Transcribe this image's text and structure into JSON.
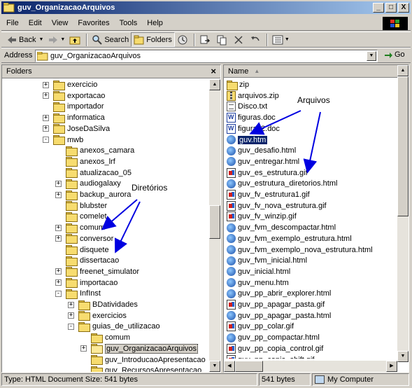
{
  "window": {
    "title": "guv_OrganizacaoArquivos"
  },
  "titlebar_buttons": [
    "_",
    "□",
    "X"
  ],
  "menu": [
    "File",
    "Edit",
    "View",
    "Favorites",
    "Tools",
    "Help"
  ],
  "toolbar": {
    "back": "Back",
    "search": "Search",
    "folders": "Folders"
  },
  "address": {
    "label": "Address",
    "value": "guv_OrganizacaoArquivos",
    "go": "Go"
  },
  "folders_pane": {
    "title": "Folders",
    "close": "×",
    "tree": [
      {
        "label": "exercicio",
        "level": 1,
        "expander": "+"
      },
      {
        "label": "exportacao",
        "level": 1,
        "expander": "+"
      },
      {
        "label": "importador",
        "level": 1,
        "expander": ""
      },
      {
        "label": "informatica",
        "level": 1,
        "expander": "+"
      },
      {
        "label": "JoseDaSilva",
        "level": 1,
        "expander": "+"
      },
      {
        "label": "mwb",
        "level": 1,
        "expander": "-"
      },
      {
        "label": "anexos_camara",
        "level": 2,
        "expander": ""
      },
      {
        "label": "anexos_lrf",
        "level": 2,
        "expander": ""
      },
      {
        "label": "atualizacao_05",
        "level": 2,
        "expander": ""
      },
      {
        "label": "audiogalaxy",
        "level": 2,
        "expander": "+"
      },
      {
        "label": "backup_aurora",
        "level": 2,
        "expander": "+"
      },
      {
        "label": "blubster",
        "level": 2,
        "expander": ""
      },
      {
        "label": "comelet",
        "level": 2,
        "expander": ""
      },
      {
        "label": "comum",
        "level": 2,
        "expander": "+"
      },
      {
        "label": "conversor",
        "level": 2,
        "expander": "+"
      },
      {
        "label": "disquete",
        "level": 2,
        "expander": ""
      },
      {
        "label": "dissertacao",
        "level": 2,
        "expander": ""
      },
      {
        "label": "freenet_simulator",
        "level": 2,
        "expander": "+"
      },
      {
        "label": "importacao",
        "level": 2,
        "expander": "+"
      },
      {
        "label": "InfInst",
        "level": 2,
        "expander": "-"
      },
      {
        "label": "BDatividades",
        "level": 3,
        "expander": "+"
      },
      {
        "label": "exercicios",
        "level": 3,
        "expander": "+"
      },
      {
        "label": "guias_de_utilizacao",
        "level": 3,
        "expander": "-"
      },
      {
        "label": "comum",
        "level": 4,
        "expander": ""
      },
      {
        "label": "guv_OrganizacaoArquivos",
        "level": 4,
        "expander": "+",
        "selected": true
      },
      {
        "label": "guv_IntroducaoApresentacao",
        "level": 4,
        "expander": ""
      },
      {
        "label": "guv_RecursosApresentacao",
        "level": 4,
        "expander": ""
      }
    ]
  },
  "files_pane": {
    "column": "Name",
    "sort_arrow": "▲",
    "items": [
      {
        "name": "zip",
        "type": "zip"
      },
      {
        "name": "arquivos.zip",
        "type": "zipfile"
      },
      {
        "name": "Disco.txt",
        "type": "txt"
      },
      {
        "name": "figuras.doc",
        "type": "doc"
      },
      {
        "name": "figuras2.doc",
        "type": "doc"
      },
      {
        "name": "guv.htm",
        "type": "html",
        "selected": true
      },
      {
        "name": "guv_desafio.html",
        "type": "html"
      },
      {
        "name": "guv_entregar.html",
        "type": "html"
      },
      {
        "name": "guv_es_estrutura.gif",
        "type": "gif"
      },
      {
        "name": "guv_estrutura_diretorios.html",
        "type": "html"
      },
      {
        "name": "guv_fv_estrutura1.gif",
        "type": "gif"
      },
      {
        "name": "guv_fv_nova_estrutura.gif",
        "type": "gif"
      },
      {
        "name": "guv_fv_winzip.gif",
        "type": "gif"
      },
      {
        "name": "guv_fvm_descompactar.html",
        "type": "html"
      },
      {
        "name": "guv_fvm_exemplo_estrutura.html",
        "type": "html"
      },
      {
        "name": "guv_fvm_exemplo_nova_estrutura.html",
        "type": "html"
      },
      {
        "name": "guv_fvm_inicial.html",
        "type": "html"
      },
      {
        "name": "guv_inicial.html",
        "type": "html"
      },
      {
        "name": "guv_menu.htm",
        "type": "html"
      },
      {
        "name": "guv_pp_abrir_explorer.html",
        "type": "html"
      },
      {
        "name": "guv_pp_apagar_pasta.gif",
        "type": "gif"
      },
      {
        "name": "guv_pp_apagar_pasta.html",
        "type": "html"
      },
      {
        "name": "guv_pp_colar.gif",
        "type": "gif"
      },
      {
        "name": "guv_pp_compactar.html",
        "type": "html"
      },
      {
        "name": "guv_pp_copia_control.gif",
        "type": "gif"
      },
      {
        "name": "guv_pp_copia_shift.gif",
        "type": "gif"
      }
    ]
  },
  "annotations": {
    "diretorios": "Diretórios",
    "arquivos": "Arquivos",
    "color": "#0000e0"
  },
  "status": {
    "left": "Type: HTML Document Size: 541 bytes",
    "size": "541 bytes",
    "zone": "My Computer"
  }
}
